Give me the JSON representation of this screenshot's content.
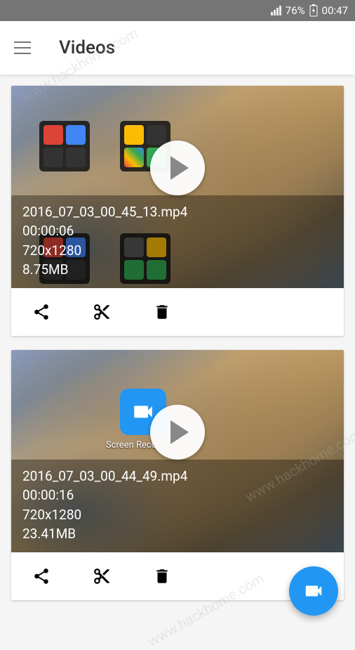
{
  "status_bar": {
    "battery": "76%",
    "time": "00:47"
  },
  "app_bar": {
    "title": "Videos"
  },
  "videos": [
    {
      "filename": "2016_07_03_00_45_13.mp4",
      "duration": "00:00:06",
      "resolution": "720x1280",
      "filesize": "8.75MB",
      "preview_type": "folders"
    },
    {
      "filename": "2016_07_03_00_44_49.mp4",
      "duration": "00:00:16",
      "resolution": "720x1280",
      "filesize": "23.41MB",
      "preview_type": "single",
      "app_label": "Screen Recor"
    }
  ],
  "watermark": "www.hackhome.com"
}
